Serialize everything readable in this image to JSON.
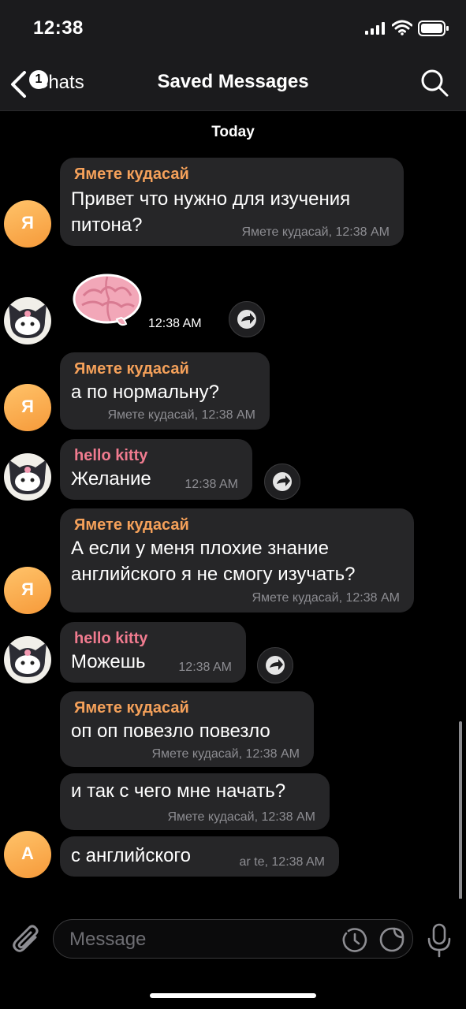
{
  "status": {
    "time": "12:38"
  },
  "nav": {
    "back_label": "Chats",
    "badge_count": "1",
    "title": "Saved Messages"
  },
  "date_separator": "Today",
  "messages": [
    {
      "sender": "Ямете кудасай",
      "text": "Привет что нужно для изучения\nпитона?",
      "meta": "Ямете кудасай, 12:38 AM"
    },
    {
      "sticker": "brain-sticker",
      "time": "12:38 AM"
    },
    {
      "sender": "Ямете кудасай",
      "text": "а по нормальну?",
      "meta": "Ямете кудасай, 12:38 AM"
    },
    {
      "sender": "hello kitty",
      "text": "Желание",
      "meta": "12:38 AM"
    },
    {
      "sender": "Ямете кудасай",
      "text": "А если у меня плохие знание\nанглийского я не смогу изучать?",
      "meta": "Ямете кудасай, 12:38 AM"
    },
    {
      "sender": "hello kitty",
      "text": "Можешь",
      "meta": "12:38 AM"
    },
    {
      "sender": "Ямете кудасай",
      "text": "оп оп повезло повезло",
      "meta": "Ямете кудасай, 12:38 AM"
    },
    {
      "text": "и так с чего мне начать?",
      "meta": "Ямете кудасай, 12:38 AM"
    },
    {
      "text": "с английского",
      "meta": "ar te, 12:38 AM"
    }
  ],
  "avatars": {
    "ya_letter": "Я",
    "a_letter": "А"
  },
  "input": {
    "placeholder": "Message"
  },
  "colors": {
    "sender_orange": "#f5a15a",
    "sender_pink": "#f07b8f",
    "bubble": "#262628",
    "avatar_orange": "#f69a3a"
  }
}
